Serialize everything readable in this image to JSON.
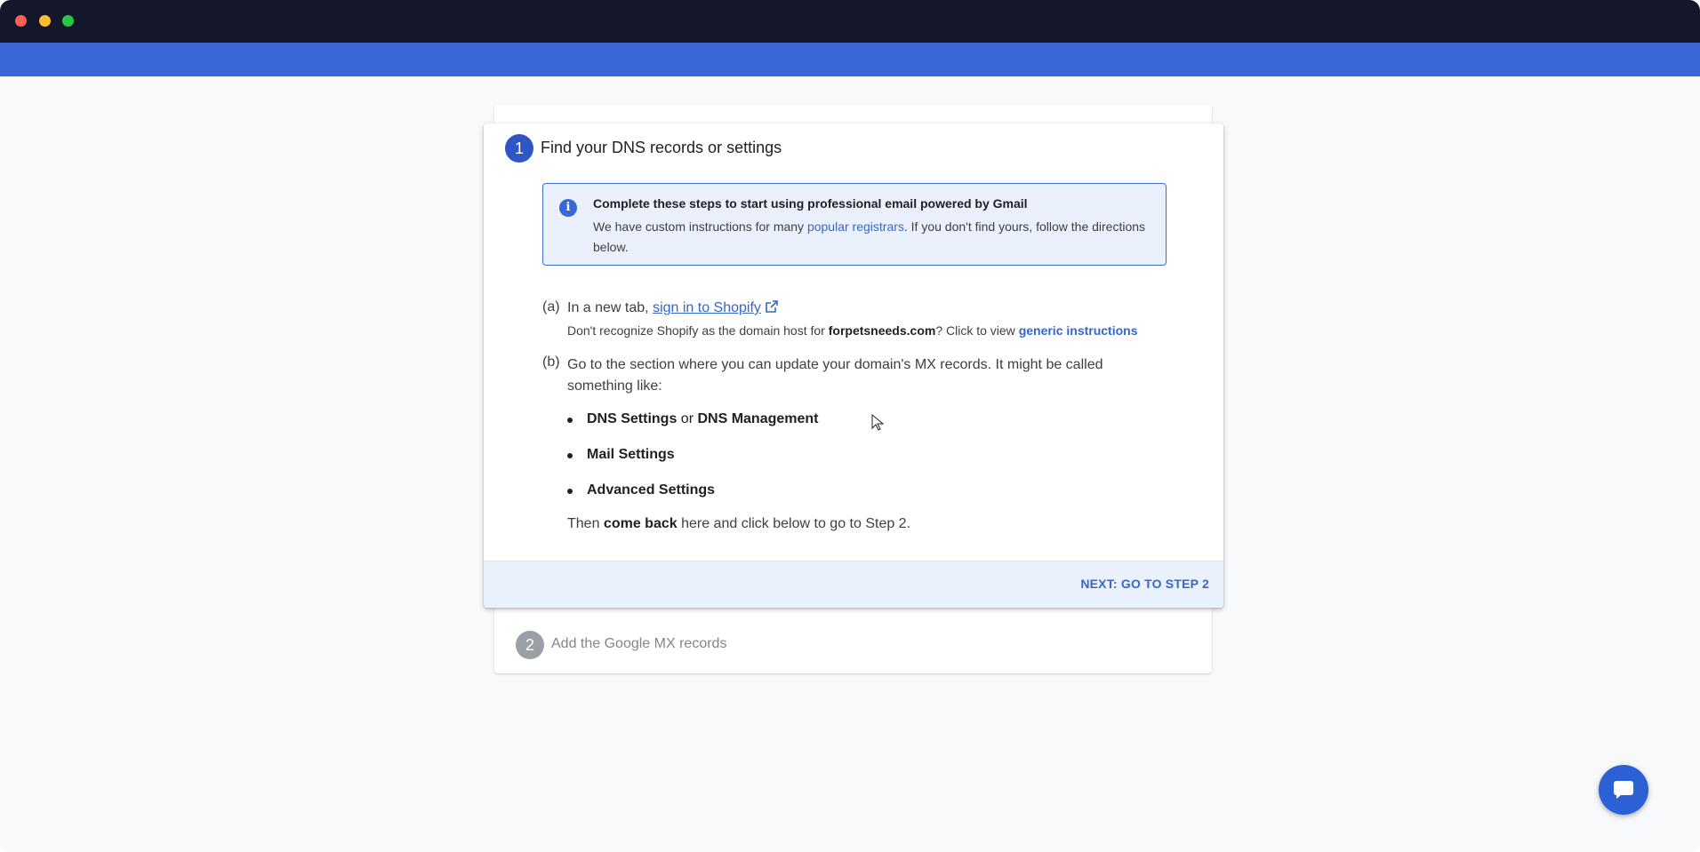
{
  "colors": {
    "titlebar": "#141629",
    "accent_bar": "#3a67d6",
    "step_active": "#2f55c6",
    "step_inactive": "#9aa0a6",
    "link": "#3567c9",
    "info_bg": "#eaf1fd"
  },
  "icons": {
    "info": "info-icon",
    "external_link": "external-link-icon",
    "chat": "chat-bubble-icon",
    "cursor": "mouse-pointer"
  },
  "step1": {
    "number": "1",
    "title": "Find your DNS records or settings",
    "info": {
      "heading": "Complete these steps to start using professional email powered by Gmail",
      "body_before": "We have custom instructions for many ",
      "body_link": "popular registrars",
      "body_after": ". If you don't find yours, follow the directions below."
    },
    "a": {
      "label": "(a)",
      "prefix": "In a new tab, ",
      "link": "sign in to Shopify",
      "note_before": "Don't recognize Shopify as the domain host for ",
      "domain": "forpetsneeds.com",
      "note_mid": "? Click to view ",
      "note_link": "generic instructions"
    },
    "b": {
      "label": "(b)",
      "text": "Go to the section where you can update your domain's MX records. It might be called something like:",
      "bullets": [
        {
          "bold1": "DNS Settings",
          "joiner": " or ",
          "bold2": "DNS Management"
        },
        {
          "bold1": "Mail Settings",
          "joiner": "",
          "bold2": ""
        },
        {
          "bold1": "Advanced Settings",
          "joiner": "",
          "bold2": ""
        }
      ],
      "then_before": "Then ",
      "then_bold": "come back",
      "then_after": " here and click below to go to Step 2."
    },
    "next_button": "NEXT: GO TO STEP 2"
  },
  "step2": {
    "number": "2",
    "title": "Add the Google MX records"
  }
}
